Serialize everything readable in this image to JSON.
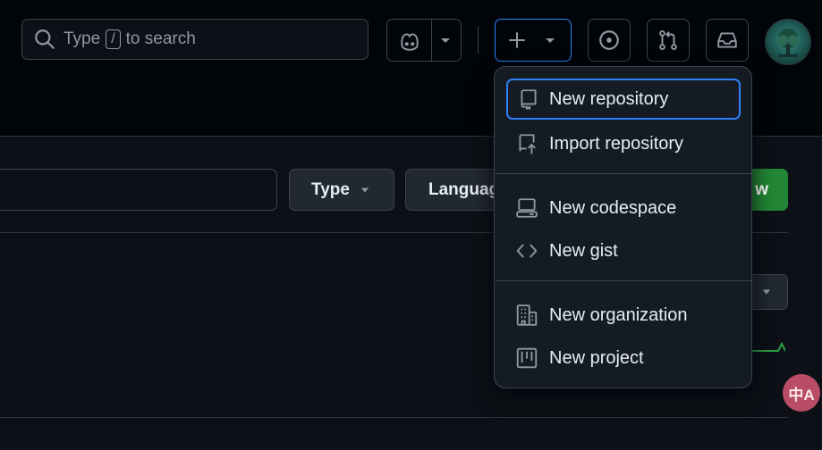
{
  "search": {
    "placeholder_prefix": "Type",
    "shortcut_key": "/",
    "placeholder_suffix": "to search",
    "icon": "search-icon"
  },
  "header_actions": {
    "copilot_icon": "copilot-icon",
    "create_icon": "plus-icon",
    "issues_icon": "issue-opened-icon",
    "pulls_icon": "git-pull-request-icon",
    "inbox_icon": "inbox-icon"
  },
  "filters": {
    "type_label": "Type",
    "language_label": "Languag",
    "new_label": "w"
  },
  "menu": {
    "items": [
      {
        "label": "New repository",
        "icon": "repo-icon",
        "focused": true
      },
      {
        "label": "Import repository",
        "icon": "repo-push-icon"
      },
      {
        "label": "New codespace",
        "icon": "codespaces-icon"
      },
      {
        "label": "New gist",
        "icon": "code-icon"
      },
      {
        "label": "New organization",
        "icon": "organization-icon"
      },
      {
        "label": "New project",
        "icon": "project-icon"
      }
    ]
  },
  "translate_badge": {
    "text": "中A"
  },
  "colors": {
    "background": "#0d1117",
    "header_background": "#010409",
    "menu_background": "#151b23",
    "border": "#3d444d",
    "focus_ring": "#2f81f7",
    "primary_button": "#238636",
    "icon": "#9198a1",
    "text": "#e6edf3"
  }
}
